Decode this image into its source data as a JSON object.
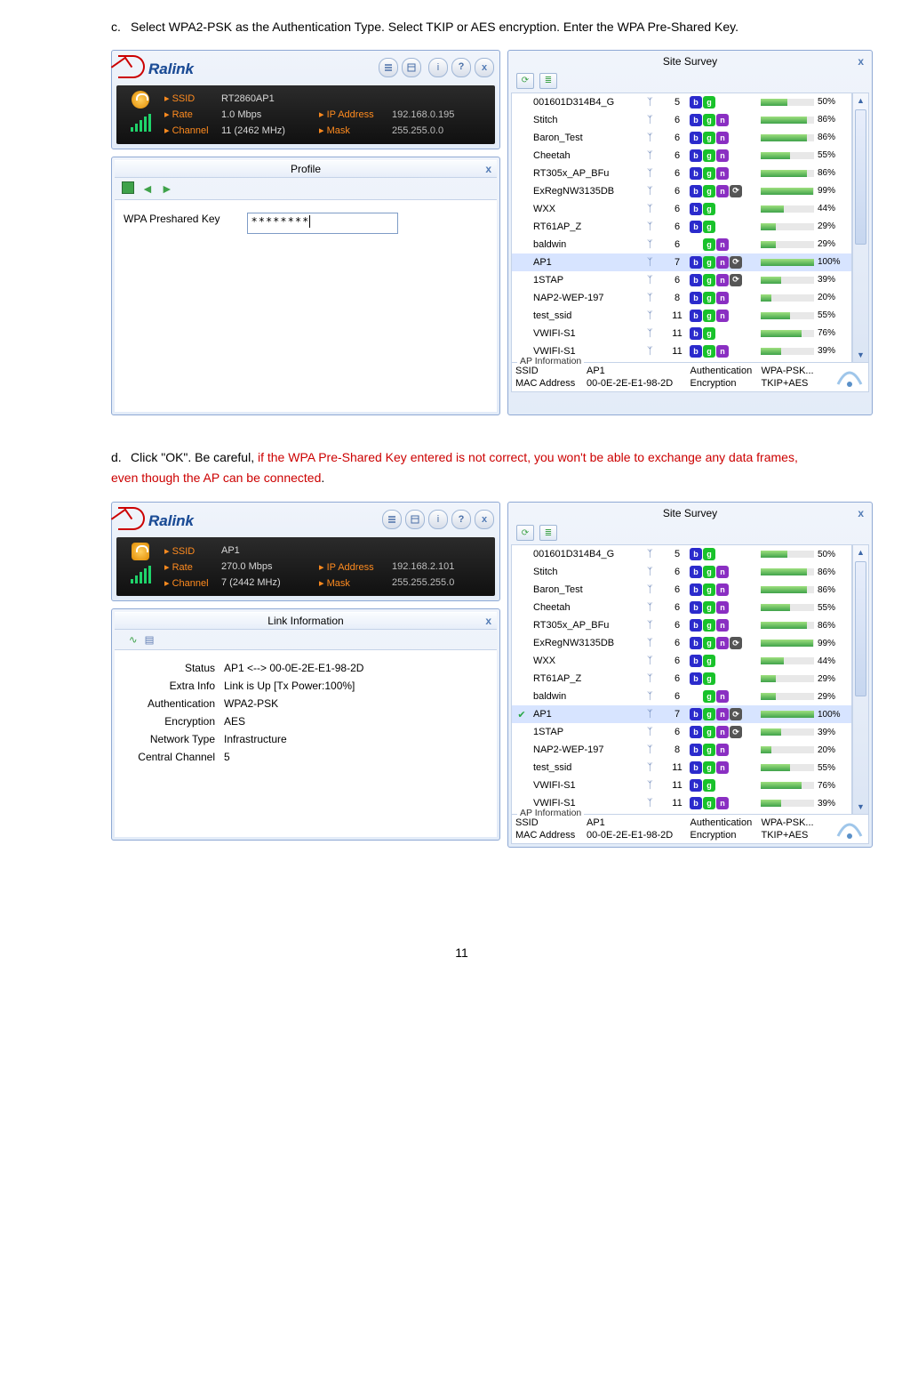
{
  "step_c": {
    "bullet": "c.",
    "text": "Select WPA2-PSK as the Authentication Type. Select TKIP or AES encryption. Enter the WPA Pre-Shared Key."
  },
  "step_d": {
    "bullet": "d.",
    "black": "Click \"OK\". Be careful, ",
    "red": "if the WPA Pre-Shared Key entered is not correct, you won't be able to exchange any data frames, even though the AP can be connected",
    "dot": "."
  },
  "page_number": "11",
  "brand": "Ralink",
  "toolbar_help": "?",
  "toolbar_close": "x",
  "status1": {
    "ssid_k": "SSID",
    "ssid": "RT2860AP1",
    "rate_k": "Rate",
    "rate": "1.0 Mbps",
    "ip_k": "IP Address",
    "ip": "192.168.0.195",
    "chan_k": "Channel",
    "chan": "11 (2462 MHz)",
    "mask_k": "Mask",
    "mask": "255.255.0.0"
  },
  "status2": {
    "ssid_k": "SSID",
    "ssid": "AP1",
    "rate_k": "Rate",
    "rate": "270.0 Mbps",
    "ip_k": "IP Address",
    "ip": "192.168.2.101",
    "chan_k": "Channel",
    "chan": "7 (2442 MHz)",
    "mask_k": "Mask",
    "mask": "255.255.255.0"
  },
  "profile": {
    "title": "Profile",
    "close": "x",
    "label": "WPA Preshared Key",
    "value": "********"
  },
  "link": {
    "title": "Link Information",
    "close": "x",
    "status_k": "Status",
    "status": "AP1 <--> 00-0E-2E-E1-98-2D",
    "extra_k": "Extra Info",
    "extra": "Link is Up  [Tx Power:100%]",
    "auth_k": "Authentication",
    "auth": "WPA2-PSK",
    "enc_k": "Encryption",
    "enc": "AES",
    "net_k": "Network Type",
    "net": "Infrastructure",
    "cch_k": "Central Channel",
    "cch": "5"
  },
  "ss": {
    "title": "Site Survey",
    "close": "x",
    "rows": [
      {
        "n": "001601D314B4_G",
        "c": "5",
        "b": [
          "b",
          "g",
          "",
          ""
        ],
        "p": 50
      },
      {
        "n": "Stitch",
        "c": "6",
        "b": [
          "b",
          "g",
          "n",
          ""
        ],
        "p": 86
      },
      {
        "n": "Baron_Test",
        "c": "6",
        "b": [
          "b",
          "g",
          "n",
          ""
        ],
        "p": 86
      },
      {
        "n": "Cheetah",
        "c": "6",
        "b": [
          "b",
          "g",
          "n",
          ""
        ],
        "p": 55
      },
      {
        "n": "RT305x_AP_BFu",
        "c": "6",
        "b": [
          "b",
          "g",
          "n",
          ""
        ],
        "p": 86
      },
      {
        "n": "ExRegNW3135DB",
        "c": "6",
        "b": [
          "b",
          "g",
          "n",
          "k"
        ],
        "p": 99
      },
      {
        "n": "WXX",
        "c": "6",
        "b": [
          "b",
          "g",
          "",
          ""
        ],
        "p": 44
      },
      {
        "n": "RT61AP_Z",
        "c": "6",
        "b": [
          "b",
          "g",
          "",
          ""
        ],
        "p": 29
      },
      {
        "n": "baldwin",
        "c": "6",
        "b": [
          "",
          "g",
          "n",
          ""
        ],
        "p": 29
      },
      {
        "n": "AP1",
        "c": "7",
        "b": [
          "b",
          "g",
          "n",
          "k"
        ],
        "p": 100
      },
      {
        "n": "1STAP",
        "c": "6",
        "b": [
          "b",
          "g",
          "n",
          "k"
        ],
        "p": 39
      },
      {
        "n": "NAP2-WEP-197",
        "c": "8",
        "b": [
          "b",
          "g",
          "n",
          ""
        ],
        "p": 20
      },
      {
        "n": "test_ssid",
        "c": "11",
        "b": [
          "b",
          "g",
          "n",
          ""
        ],
        "p": 55
      },
      {
        "n": "VWIFI-S1",
        "c": "11",
        "b": [
          "b",
          "g",
          "",
          ""
        ],
        "p": 76
      },
      {
        "n": "VWIFI-S1",
        "c": "11",
        "b": [
          "b",
          "g",
          "n",
          ""
        ],
        "p": 39
      }
    ],
    "ap": {
      "legend": "AP Information",
      "ssid_k": "SSID",
      "ssid": "AP1",
      "mac_k": "MAC Address",
      "mac": "00-0E-2E-E1-98-2D",
      "auth_k": "Authentication",
      "auth": "WPA-PSK...",
      "enc_k": "Encryption",
      "enc": "TKIP+AES"
    }
  }
}
